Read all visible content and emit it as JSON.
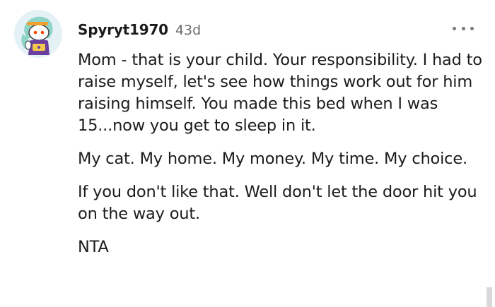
{
  "comment": {
    "username": "Spyryt1970",
    "age": "43d",
    "paragraphs": [
      "Mom - that is your child. Your responsibility. I had to raise myself, let's see how things work out for him raising himself. You made this bed when I was 15...now you get to sleep in it.",
      "My cat. My home. My money. My time. My choice.",
      "If you don't like that. Well don't let the door hit you on the way out.",
      "NTA"
    ],
    "avatar_icon": "reddit-snoo-avatar-icon",
    "more_icon": "more-options-icon"
  },
  "colors": {
    "text": "#1c1c1c",
    "meta": "#6b6b6b",
    "avatar_bg": "#e4f1f5"
  }
}
